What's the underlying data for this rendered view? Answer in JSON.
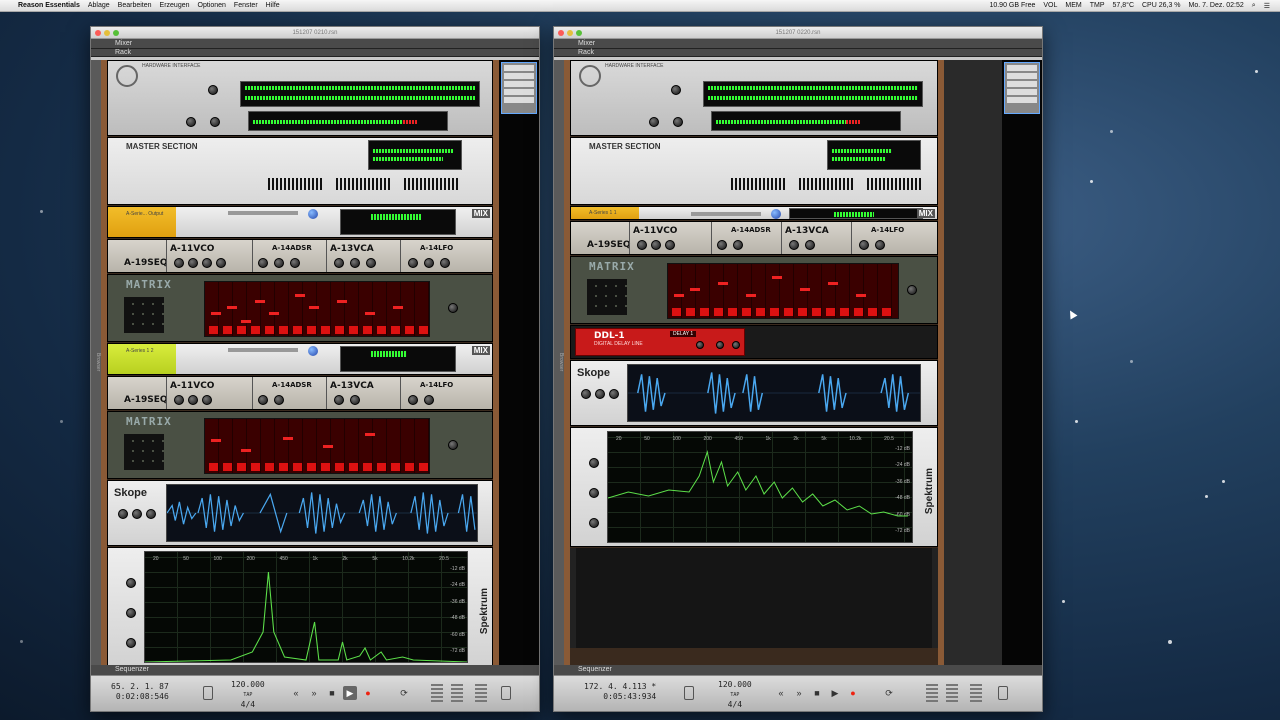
{
  "menubar": {
    "app_name": "Reason Essentials",
    "menus": [
      "Ablage",
      "Bearbeiten",
      "Erzeugen",
      "Optionen",
      "Fenster",
      "Hilfe"
    ],
    "free_space": "10.90 GB Free",
    "vol": "VOL",
    "mem": "MEM",
    "tmp": "TMP",
    "temp_value": "57,8°C",
    "cpu": "CPU 26,3 %",
    "datetime": "Mo. 7. Dez.  02:52"
  },
  "left_window": {
    "title": "151207 0210.rsn",
    "panel_mixer": "Mixer",
    "panel_rack": "Rack",
    "browser_label": "Browser",
    "sequencer_label": "Sequenzer",
    "hw_label": "HARDWARE INTERFACE",
    "master_label": "MASTER SECTION",
    "mix_channel_1": "A-Serie... Output",
    "mix_channel_2": "A-Series 1 2",
    "aseries_names": [
      "A-19SEQ",
      "A-11VCO",
      "A-14ADSR",
      "A-13VCA",
      "A-14LFO"
    ],
    "matrix_label": "MATRIX",
    "skope_label": "Skope",
    "spektrum_label": "Spektrum",
    "mix_tag": "MIX",
    "spek_freq": [
      "20",
      "50",
      "100",
      "200",
      "450",
      "1k",
      "2k",
      "5k",
      "10.2k",
      "20.5"
    ],
    "spek_db": [
      "-12 dB",
      "-24 dB",
      "-36 dB",
      "-48 dB",
      "-60 dB",
      "-72 dB"
    ],
    "transport": {
      "position_bars": "65.  2.  1.  87",
      "position_time": "0:02:08:546",
      "tempo": "120.000",
      "signature": "4/4",
      "tap": "TAP"
    }
  },
  "right_window": {
    "title": "151207 0220.rsn",
    "panel_mixer": "Mixer",
    "panel_rack": "Rack",
    "browser_label": "Browser",
    "sequencer_label": "Sequenzer",
    "hw_label": "HARDWARE INTERFACE",
    "master_label": "MASTER SECTION",
    "mix_channel_1": "A-Series 1 1",
    "aseries_names": [
      "A-19SEQ",
      "A-11VCO",
      "A-14ADSR",
      "A-13VCA",
      "A-14LFO"
    ],
    "matrix_label": "MATRIX",
    "ddl_label": "DDL-1",
    "ddl_sub": "DIGITAL DELAY LINE",
    "ddl_patch": "DELAY 1",
    "skope_label": "Skope",
    "spektrum_label": "Spektrum",
    "mix_tag": "MIX",
    "spek_freq": [
      "20",
      "50",
      "100",
      "200",
      "450",
      "1k",
      "2k",
      "5k",
      "10.2k",
      "20.5"
    ],
    "spek_db": [
      "-12 dB",
      "-24 dB",
      "-36 dB",
      "-48 dB",
      "-60 dB",
      "-72 dB"
    ],
    "transport": {
      "position_bars": "172.  4.  4.113 *",
      "position_time": "0:05:43:934",
      "tempo": "120.000",
      "signature": "4/4",
      "tap": "TAP"
    }
  },
  "icons": {
    "rewind": "«",
    "forward": "»",
    "stop": "■",
    "play": "▶",
    "record": "●",
    "loop": "⟳"
  },
  "colors": {
    "rack_wood": "#8a5a36",
    "yellow_channel": "#f2bd2a",
    "green_channel": "#d8ec3c",
    "skope_wave": "#4aa8f0",
    "spektrum_line": "#5de04a",
    "ddl_red": "#c81a1a"
  }
}
